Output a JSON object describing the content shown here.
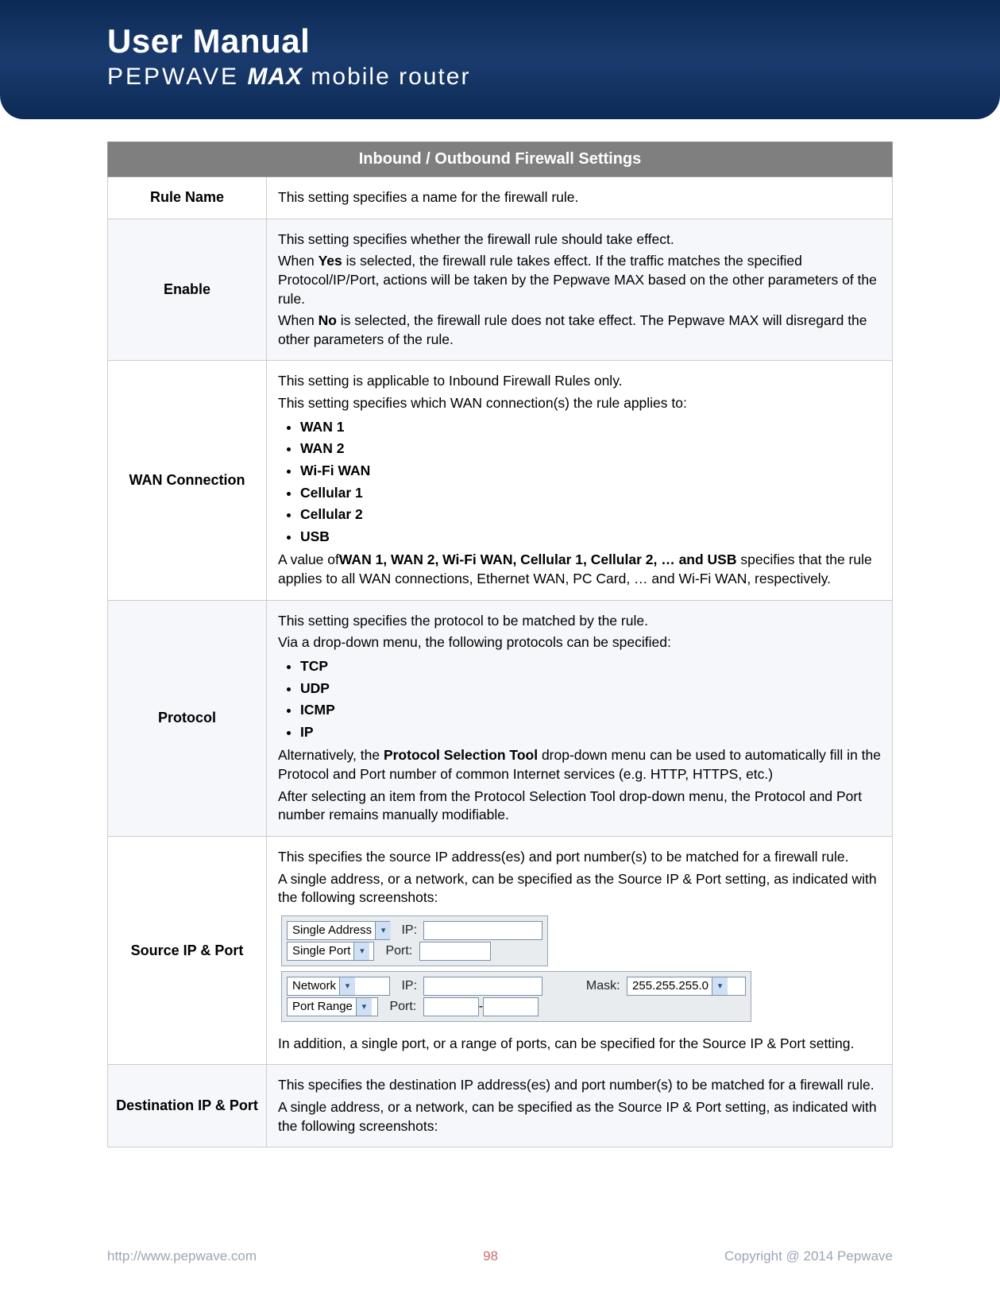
{
  "header": {
    "title": "User Manual",
    "brand": "PEPWAVE",
    "max": "MAX",
    "subtitle_rest": " mobile router"
  },
  "table": {
    "title": "Inbound / Outbound Firewall Settings",
    "rows": [
      {
        "label": "Rule Name",
        "paras": [
          "This setting specifies a name for the firewall rule."
        ]
      },
      {
        "label": "Enable",
        "intro": "This setting specifies whether the firewall rule should take effect.",
        "yes_pre": "When ",
        "yes_bold": "Yes",
        "yes_post": " is selected, the firewall rule takes effect.  If the traffic matches the specified Protocol/IP/Port, actions will be taken by the Pepwave MAX based on the other parameters of the rule.",
        "no_pre": "When ",
        "no_bold": "No",
        "no_post": " is selected, the firewall rule does not take effect. The Pepwave MAX will disregard the other parameters of the rule."
      },
      {
        "label": "WAN Connection",
        "intro1": "This setting is applicable to Inbound Firewall Rules only.",
        "intro2": "This setting specifies which WAN connection(s) the rule applies to:",
        "items": [
          "WAN 1",
          "WAN 2",
          "Wi-Fi WAN",
          "Cellular 1",
          "Cellular 2",
          "USB"
        ],
        "after_pre": "A value of",
        "after_bold": "WAN 1, WAN 2, Wi-Fi WAN, Cellular 1, Cellular 2, … and USB",
        "after_post": " specifies that the rule applies to all WAN connections, Ethernet WAN, PC Card, … and Wi-Fi WAN, respectively."
      },
      {
        "label": "Protocol",
        "intro1": "This setting specifies the protocol to be matched by the rule.",
        "intro2": "Via a drop-down menu, the following protocols can be specified:",
        "items": [
          "TCP",
          "UDP",
          "ICMP",
          "IP"
        ],
        "alt_pre": "Alternatively, the ",
        "alt_bold": "Protocol Selection Tool",
        "alt_post": " drop-down menu can be used to automatically fill in the Protocol and Port number of common Internet services (e.g. HTTP, HTTPS, etc.)",
        "tail": "After selecting an item from the Protocol Selection Tool drop-down menu, the Protocol and Port number remains manually modifiable."
      },
      {
        "label": "Source IP & Port",
        "intro1": "This specifies the source IP address(es) and port number(s) to be matched for a firewall rule.",
        "intro2": "A single address, or a network, can be specified as the Source IP & Port setting, as indicated with the following screenshots:",
        "shot1": {
          "row1_dd": "Single Address",
          "row1_lbl": "IP:",
          "row1_val": "",
          "row2_dd": "Single Port",
          "row2_lbl": "Port:",
          "row2_val": ""
        },
        "shot2": {
          "row1_dd": "Network",
          "row1_lbl": "IP:",
          "row1_val": "",
          "mask_lbl": "Mask:",
          "mask_val": "255.255.255.0",
          "row2_dd": "Port Range",
          "row2_lbl": "Port:",
          "row2_val": "",
          "row2_sep": "-"
        },
        "tail": "In addition, a single port, or a range of ports, can be specified for the Source IP & Port setting."
      },
      {
        "label": "Destination IP & Port",
        "intro1": "This specifies the destination IP address(es) and port number(s) to be matched for a firewall rule.",
        "intro2": "A single address, or a network, can be specified as the Source IP & Port setting, as indicated with the following screenshots:"
      }
    ]
  },
  "footer": {
    "url": "http://www.pepwave.com",
    "page": "98",
    "copyright": "Copyright @ 2014 Pepwave"
  }
}
